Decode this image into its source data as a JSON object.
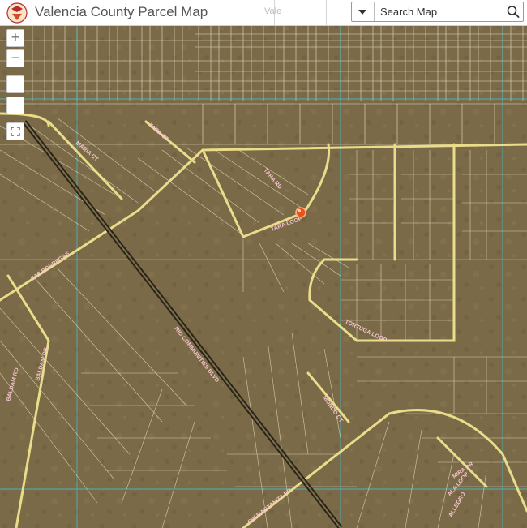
{
  "header": {
    "title": "Valencia County Parcel Map",
    "partial_label": "Vale",
    "search_placeholder": "Search Map"
  },
  "map_controls": {
    "zoom_in": "+",
    "zoom_out": "−"
  },
  "colors": {
    "terrain": "#7a6a48",
    "parcel_line": "#e6dcc0",
    "road": "#eadc8a",
    "section_line": "#44c4d0",
    "highway": "#2a2418",
    "road_label": "#f4c4cc",
    "marker": "#e8541e"
  },
  "road_labels": [
    "TARA CT",
    "MARIA CT",
    "TARA RD",
    "TARA LOOP",
    "LAS BORREGAS",
    "RIO COMMUNITIES BLVD",
    "BALDAM DR",
    "BALDAM RD",
    "TORTUGA LOOP",
    "MONDO CT",
    "SW MANZANITA DR",
    "MIRA DR",
    "ALA LOOP",
    "ALLEGRO"
  ]
}
